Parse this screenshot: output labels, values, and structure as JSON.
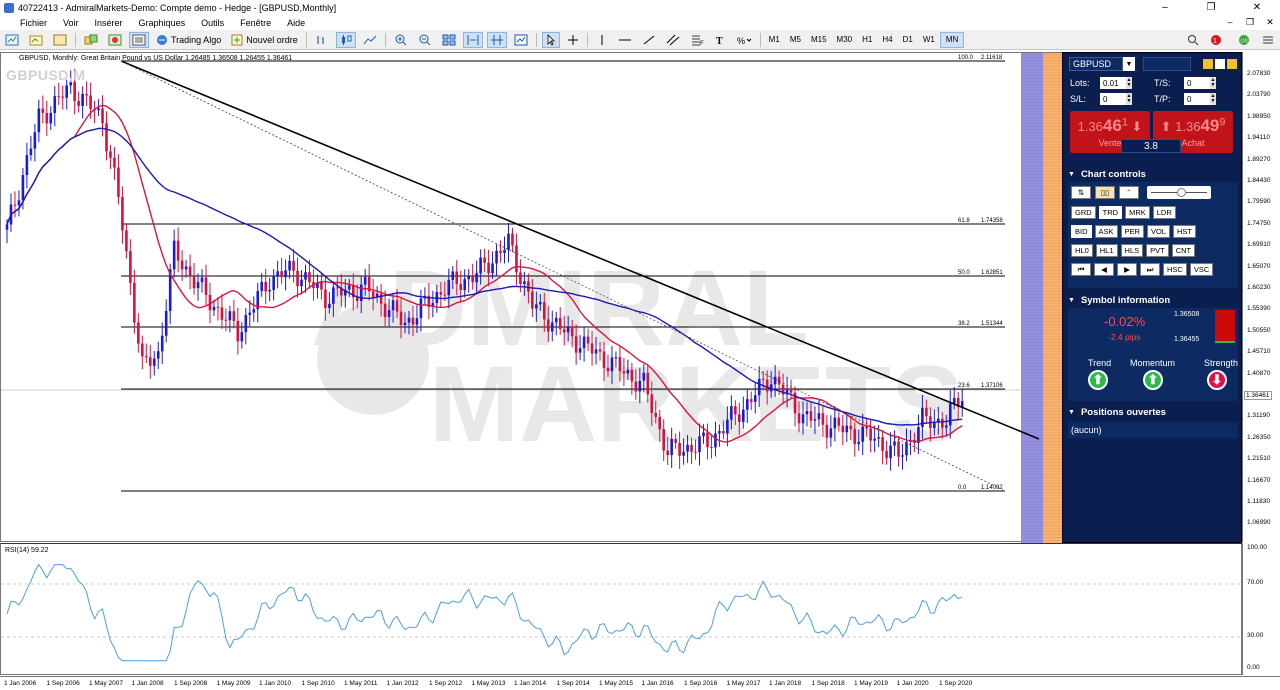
{
  "window": {
    "title": "40722413 - AdmiralMarkets-Demo: Compte demo - Hedge - [GBPUSD,Monthly]",
    "min_glyph": "–",
    "max_glyph": "❐",
    "close_glyph": "✕"
  },
  "menu": [
    "Fichier",
    "Voir",
    "Insérer",
    "Graphiques",
    "Outils",
    "Fenêtre",
    "Aide"
  ],
  "toolbar": {
    "trading_algo": "Trading Algo",
    "new_order": "Nouvel ordre",
    "timeframes": [
      "M1",
      "M5",
      "M15",
      "M30",
      "H1",
      "H4",
      "D1",
      "W1",
      "MN"
    ],
    "active_timeframe": "MN"
  },
  "chart": {
    "symbol_watermark": "GBPUSD,M",
    "info_line": "GBPUSD, Monthly:  Great Britain Pound vs US Dollar  1.26485 1.36508 1.26455 1.36461",
    "watermark_line1": "ADMIRAL",
    "watermark_line2": "MARKETS",
    "fib_levels": [
      {
        "pct": "100.0",
        "price": "2.11618"
      },
      {
        "pct": "61.8",
        "price": "1.74358"
      },
      {
        "pct": "50.0",
        "price": "1.62851"
      },
      {
        "pct": "38.2",
        "price": "1.51344"
      },
      {
        "pct": "23.6",
        "price": "1.37106"
      },
      {
        "pct": "0.0",
        "price": "1.14092"
      }
    ],
    "price_axis": [
      "2.07830",
      "2.03790",
      "1.98950",
      "1.94110",
      "1.89270",
      "1.84430",
      "1.79590",
      "1.74750",
      "1.69910",
      "1.65070",
      "1.60230",
      "1.55390",
      "1.50550",
      "1.45710",
      "1.40870",
      "1.36461",
      "1.31190",
      "1.26350",
      "1.21510",
      "1.16670",
      "1.11830",
      "1.06990"
    ],
    "current_price": "1.36461"
  },
  "rsi": {
    "label": "RSI(14) 59.22",
    "axis": [
      "100.00",
      "70.00",
      "30.00",
      "0.00"
    ]
  },
  "date_axis": [
    "1 Jan 2006",
    "1 Sep 2006",
    "1 May 2007",
    "1 Jan 2008",
    "1 Sep 2008",
    "1 May 2009",
    "1 Jan 2010",
    "1 Sep 2010",
    "1 May 2011",
    "1 Jan 2012",
    "1 Sep 2012",
    "1 May 2013",
    "1 Jan 2014",
    "1 Sep 2014",
    "1 May 2015",
    "1 Jan 2016",
    "1 Sep 2016",
    "1 May 2017",
    "1 Jan 2018",
    "1 Sep 2018",
    "1 May 2019",
    "1 Jan 2020",
    "1 Sep 2020"
  ],
  "panel": {
    "symbol": "GBPUSD",
    "lots_label": "Lots:",
    "lots_value": "0.01",
    "sl_label": "S/L:",
    "sl_value": "0",
    "ts_label": "T/S:",
    "ts_value": "0",
    "tp_label": "T/P:",
    "tp_value": "0",
    "sell_small": "1.36",
    "sell_big": "46",
    "sell_sup": "1",
    "sell_label": "Vente",
    "buy_small": "1.36",
    "buy_big": "49",
    "buy_sup": "9",
    "buy_label": "Achat",
    "spread": "3.8",
    "chart_controls_title": "Chart controls",
    "cc_row2": [
      "GRD",
      "TRD",
      "MRK",
      "LDR"
    ],
    "cc_row3": [
      "BID",
      "ASK",
      "PER",
      "VOL",
      "HST"
    ],
    "cc_row4": [
      "HL0",
      "HL1",
      "HLS",
      "PVT",
      "CNT"
    ],
    "cc_row5": [
      "⏮",
      "◀",
      "▶",
      "⏭",
      "HSC",
      "VSC"
    ],
    "symbol_info_title": "Symbol information",
    "change_pct": "-0.02%",
    "change_pips": "-2.4 pips",
    "high": "1.36508",
    "low": "1.36455",
    "trend_label": "Trend",
    "momentum_label": "Momentum",
    "strength_label": "Strength",
    "positions_title": "Positions ouvertes",
    "positions_value": "(aucun)"
  },
  "colors": {
    "panel_bg": "#0a1f4f",
    "sell_red": "#c0141a",
    "bull_candle": "#1a1ad8",
    "bear_candle": "#d8103c",
    "ma_fast": "#e0143c",
    "ma_slow": "#1a1ab4",
    "rsi_line": "#4aa0e8",
    "up_green": "#2db84a",
    "down_pink": "#e0104a"
  }
}
